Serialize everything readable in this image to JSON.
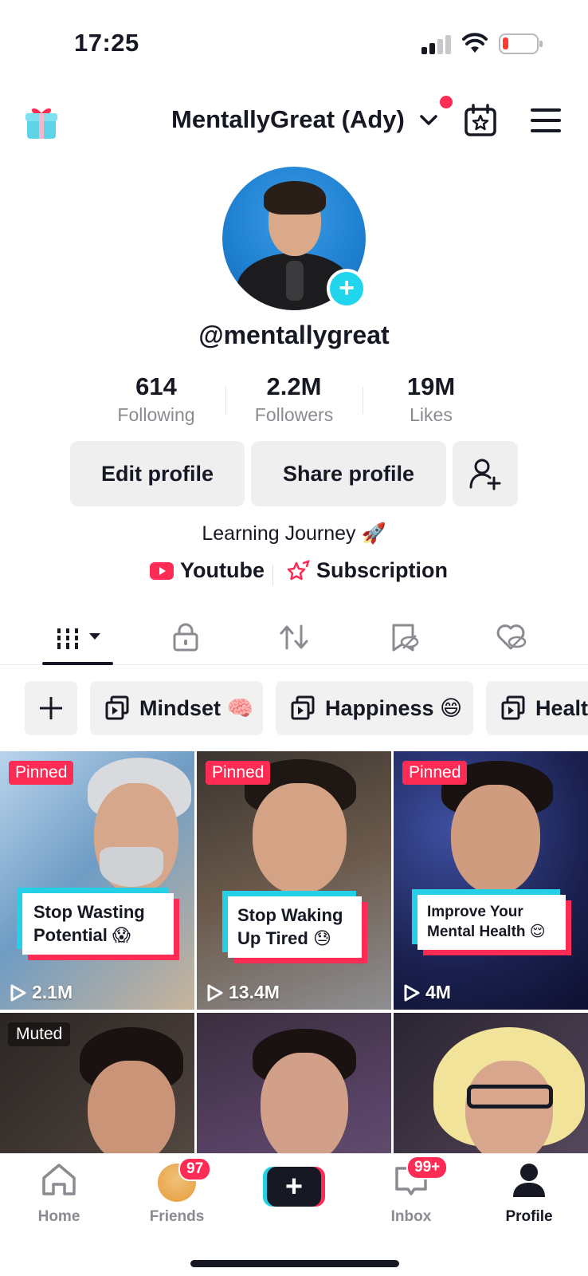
{
  "status_bar": {
    "time": "17:25"
  },
  "header": {
    "account_name": "MentallyGreat (Ady)"
  },
  "profile": {
    "username": "@mentallygreat",
    "stats": [
      {
        "value": "614",
        "label": "Following"
      },
      {
        "value": "2.2M",
        "label": "Followers"
      },
      {
        "value": "19M",
        "label": "Likes"
      }
    ],
    "buttons": {
      "edit": "Edit profile",
      "share": "Share profile"
    },
    "bio": "Learning Journey 🚀",
    "links": [
      {
        "label": "Youtube",
        "icon": "youtube-icon"
      },
      {
        "label": "Subscription",
        "icon": "subscription-star-icon"
      }
    ]
  },
  "tabs": [
    {
      "name": "videos-grid",
      "icon": "grid-icon",
      "active": true
    },
    {
      "name": "private",
      "icon": "lock-icon",
      "active": false
    },
    {
      "name": "reposts",
      "icon": "repost-icon",
      "active": false
    },
    {
      "name": "favorites",
      "icon": "bookmark-hidden-icon",
      "active": false
    },
    {
      "name": "liked",
      "icon": "heart-hidden-icon",
      "active": false
    }
  ],
  "playlists": [
    {
      "label": "Mindset 🧠"
    },
    {
      "label": "Happiness 😄"
    },
    {
      "label": "Health"
    }
  ],
  "videos": [
    {
      "badge": "Pinned",
      "caption_line1": "Stop Wasting",
      "caption_line2": "Potential 😱",
      "views": "2.1M"
    },
    {
      "badge": "Pinned",
      "caption_line1": "Stop Waking",
      "caption_line2": "Up Tired 😓",
      "views": "13.4M"
    },
    {
      "badge": "Pinned",
      "caption_line1": "Improve Your",
      "caption_line2": "Mental Health 😌",
      "views": "4M"
    },
    {
      "badge": "Muted",
      "caption_line1": "",
      "caption_line2": "",
      "views": ""
    },
    {
      "badge": "",
      "caption_line1": "",
      "caption_line2": "",
      "views": ""
    },
    {
      "badge": "",
      "caption_line1": "",
      "caption_line2": "",
      "views": ""
    }
  ],
  "bottom_nav": [
    {
      "label": "Home",
      "icon": "home-icon",
      "badge": ""
    },
    {
      "label": "Friends",
      "icon": "friends-avatar-icon",
      "badge": "97"
    },
    {
      "label": "",
      "icon": "create-plus-icon",
      "badge": ""
    },
    {
      "label": "Inbox",
      "icon": "inbox-icon",
      "badge": "99+"
    },
    {
      "label": "Profile",
      "icon": "profile-icon",
      "badge": ""
    }
  ],
  "colors": {
    "accent_red": "#fe2c55",
    "accent_cyan": "#25d0e6",
    "text": "#161823",
    "muted_text": "#8a8b91"
  }
}
